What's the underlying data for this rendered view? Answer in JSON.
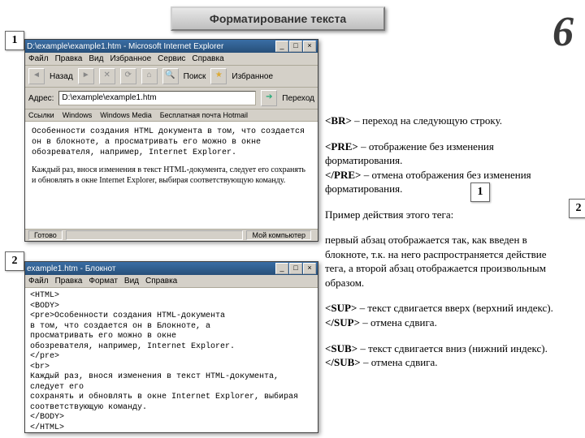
{
  "slide": {
    "title": "Форматирование текста",
    "page_number": "6",
    "badges": {
      "b1": "1",
      "b2": "2",
      "b3": "1",
      "b4": "2"
    }
  },
  "right": {
    "p1a": "<BR>",
    "p1b": " – переход на следующую строку.",
    "p2a": "<PRE>",
    "p2b": " – отображение без изменения форматирования.",
    "p2c": "</PRE>",
    "p2d": " – отмена отображения без изменения форматирования.",
    "p3": "Пример действия этого тега:",
    "p4": "первый абзац отображается так, как введен в блокноте, т.к. на него распространяется действие тега, а второй абзац отображается произвольным образом.",
    "p5a": "<SUP>",
    "p5b": " – текст сдвигается вверх (верхний индекс).",
    "p5c": "</SUP>",
    "p5d": " – отмена сдвига.",
    "p6a": "<SUB>",
    "p6b": " – текст сдвигается вниз (нижний индекс).",
    "p6c": "</SUB>",
    "p6d": " – отмена сдвига."
  },
  "ie": {
    "title": "D:\\example\\example1.htm - Microsoft Internet Explorer",
    "menu": [
      "Файл",
      "Правка",
      "Вид",
      "Избранное",
      "Сервис",
      "Справка"
    ],
    "nav": {
      "back": "Назад",
      "search": "Поиск",
      "fav": "Избранное"
    },
    "addr_label": "Адрес:",
    "addr_value": "D:\\example\\example1.htm",
    "go": "Переход",
    "links": [
      "Ссылки",
      "Windows",
      "Windows Media",
      "Бесплатная почта Hotmail"
    ],
    "body_p1": "Особенности создания HTML документа в том, что создается он в блокноте, а просматривать его можно в окне обозревателя, например, Internet Explorer.",
    "body_p2": "Каждый раз, внося изменения в текст HTML-документа, следует его сохранять и обновлять в окне Internet Explorer, выбирая соответствующую команду.",
    "status_left": "Готово",
    "status_right": "Мой компьютер"
  },
  "np": {
    "title": "example1.htm - Блокнот",
    "menu": [
      "Файл",
      "Правка",
      "Формат",
      "Вид",
      "Справка"
    ],
    "body": "<HTML>\n<BODY>\n<pre>Особенности создания HTML-документа\nв том, что создается он в Блокноте, а\nпросматривать его можно в окне\nобозревателя, например, Internet Explorer.\n</pre>\n<br>\nКаждый раз, внося изменения в текст HTML-документа, следует его\nсохранять и обновлять в окне Internet Explorer, выбирая\nсоответствующую команду.\n</BODY>\n</HTML>"
  }
}
